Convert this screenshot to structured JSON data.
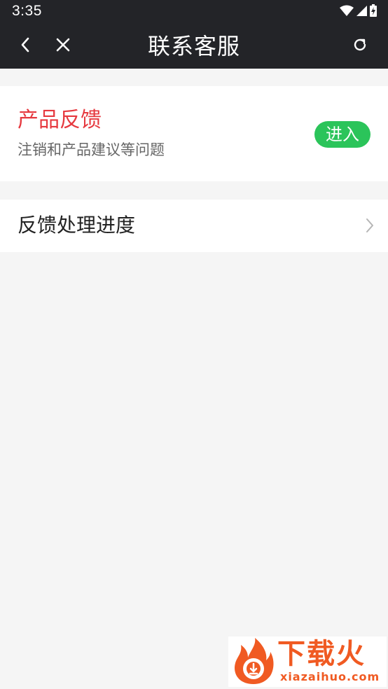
{
  "status_bar": {
    "time": "3:35",
    "icons": [
      "wifi-icon",
      "signal-icon",
      "battery-charging-icon"
    ]
  },
  "nav": {
    "title": "联系客服",
    "icons": [
      "chevron-left-icon",
      "close-icon",
      "refresh-icon"
    ]
  },
  "feedback_card": {
    "title": "产品反馈",
    "subtitle": "注销和产品建议等问题",
    "button_label": "进入"
  },
  "progress_item": {
    "label": "反馈处理进度",
    "icon": "chevron-right-icon"
  },
  "watermark": {
    "text_cn": "下载火",
    "text_en": "xiazaihuo.com"
  },
  "colors": {
    "header_bg": "#232428",
    "accent_red": "#e6393f",
    "button_green": "#2bc45a",
    "page_bg": "#f5f5f5",
    "watermark_orange": "#f05a22"
  }
}
